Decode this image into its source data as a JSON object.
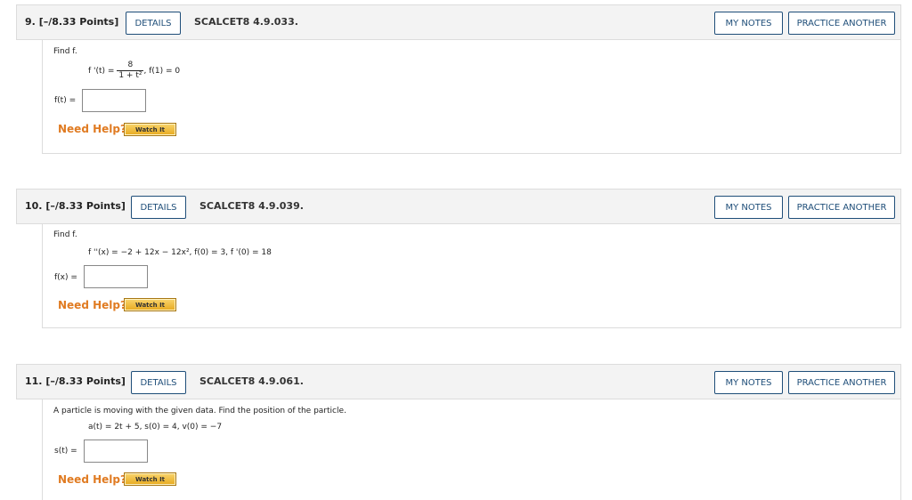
{
  "questions": [
    {
      "number": "9.",
      "points": "[–/8.33 Points]",
      "details_label": "DETAILS",
      "code": "SCALCET8 4.9.033.",
      "my_notes_label": "MY NOTES",
      "practice_label": "PRACTICE ANOTHER",
      "prompt": "Find f.",
      "given_lhs": "f '(t) =",
      "frac_num": "8",
      "frac_den": "1 + t²",
      "given_rest": ",    f(1) = 0",
      "answer_label": "f(t) =",
      "answer_value": "",
      "need_help": "Need Help?",
      "watch_label": "Watch It"
    },
    {
      "number": "10.",
      "points": "[–/8.33 Points]",
      "details_label": "DETAILS",
      "code": "SCALCET8 4.9.039.",
      "my_notes_label": "MY NOTES",
      "practice_label": "PRACTICE ANOTHER",
      "prompt": "Find f.",
      "given": "f ''(x) = −2 + 12x − 12x²,    f(0) = 3,    f '(0) = 18",
      "answer_label": "f(x) =",
      "answer_value": "",
      "need_help": "Need Help?",
      "watch_label": "Watch It"
    },
    {
      "number": "11.",
      "points": "[–/8.33 Points]",
      "details_label": "DETAILS",
      "code": "SCALCET8 4.9.061.",
      "my_notes_label": "MY NOTES",
      "practice_label": "PRACTICE ANOTHER",
      "prompt": "A particle is moving with the given data. Find the position of the particle.",
      "given": "a(t) = 2t + 5,    s(0) = 4,    v(0) = −7",
      "answer_label": "s(t) =",
      "answer_value": "",
      "need_help": "Need Help?",
      "watch_label": "Watch It"
    }
  ]
}
